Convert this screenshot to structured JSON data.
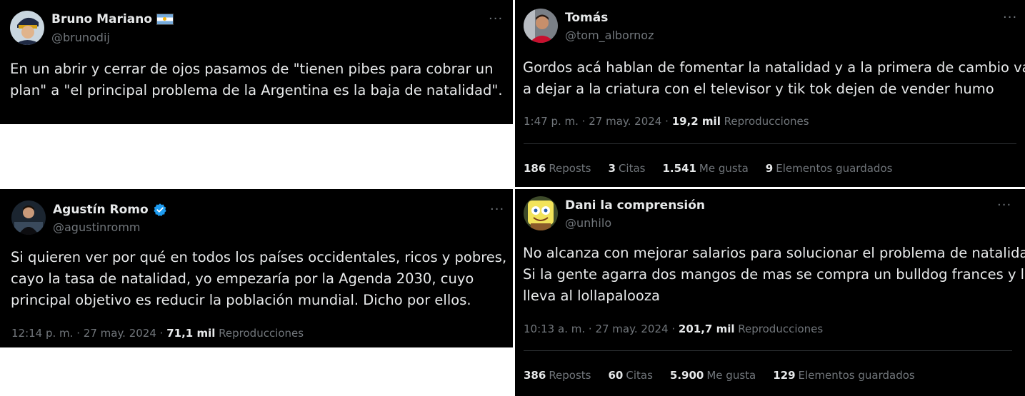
{
  "tweets": [
    {
      "name": "Bruno Mariano",
      "handle": "@brunodij",
      "flag_icon": "argentina-flag-icon",
      "text_lines": [
        "En un abrir y cerrar de ojos pasamos de \"tienen pibes para cobrar un",
        "plan\" a \"el principal problema de la Argentina es la baja de natalidad\"."
      ]
    },
    {
      "name": "Tomás",
      "handle": "@tom_albornoz",
      "text_lines": [
        "Gordos acá hablan de fomentar la natalidad y a la primera de cambio van",
        "a dejar a la criatura con el televisor y tik tok dejen de vender humo"
      ],
      "time": "1:47 p. m.",
      "date": "27 may. 2024",
      "views": "19,2 mil",
      "views_label": "Reproducciones",
      "stats": [
        {
          "value": "186",
          "label": "Reposts"
        },
        {
          "value": "3",
          "label": "Citas"
        },
        {
          "value": "1.541",
          "label": "Me gusta"
        },
        {
          "value": "9",
          "label": "Elementos guardados"
        }
      ]
    },
    {
      "name": "Agustín Romo",
      "handle": "@agustinromm",
      "verified_icon": "verified-badge-icon",
      "text_lines": [
        "Si quieren ver por qué en todos los países occidentales, ricos y pobres,",
        "cayo la tasa de natalidad, yo empezaría por la Agenda 2030, cuyo",
        "principal objetivo es reducir la población mundial. Dicho por ellos."
      ],
      "time": "12:14 p. m.",
      "date": "27 may. 2024",
      "views": "71,1 mil",
      "views_label": "Reproducciones"
    },
    {
      "name": "Dani la comprensión",
      "handle": "@unhilo",
      "text_lines": [
        "No alcanza con mejorar salarios para solucionar el problema de natalidad.",
        "Si la gente agarra dos mangos de mas se compra un bulldog frances y lo",
        "lleva al lollapalooza"
      ],
      "time": "10:13 a. m.",
      "date": "27 may. 2024",
      "views": "201,7 mil",
      "views_label": "Reproducciones",
      "stats": [
        {
          "value": "386",
          "label": "Reposts"
        },
        {
          "value": "60",
          "label": "Citas"
        },
        {
          "value": "5.900",
          "label": "Me gusta"
        },
        {
          "value": "129",
          "label": "Elementos guardados"
        }
      ]
    }
  ],
  "more_label": "···",
  "meta_sep": "·"
}
